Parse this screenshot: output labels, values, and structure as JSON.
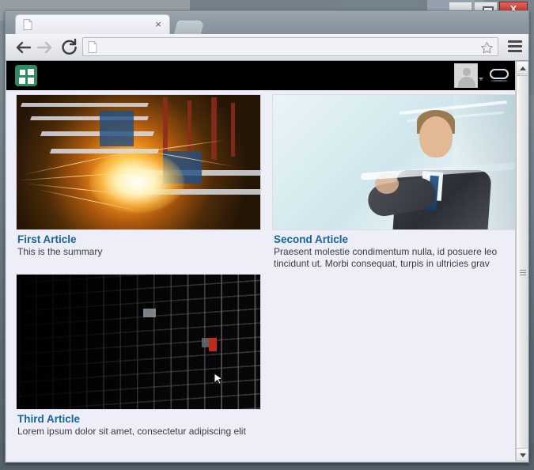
{
  "window": {
    "controls": {
      "minimize_label": "Minimize",
      "maximize_label": "Restore",
      "close_label": "X"
    }
  },
  "browser": {
    "tab": {
      "title": "",
      "favicon": "document-icon",
      "close_label": "×"
    },
    "new_tab_label": "",
    "toolbar": {
      "back_icon": "back-arrow-icon",
      "forward_icon": "forward-arrow-icon",
      "reload_icon": "reload-icon",
      "omnibox_value": "",
      "omnibox_placeholder": "",
      "omnibox_icon": "document-icon",
      "bookmark_icon": "star-icon",
      "menu_icon": "hamburger-menu-icon"
    }
  },
  "app": {
    "header": {
      "logo_name": "grid-logo",
      "logo_color": "#2e8b62",
      "avatar_name": "user-avatar",
      "avatar_caret": "chevron-down-icon",
      "chat_icon": "chat-bubble-icon"
    },
    "page_background": "#eeeef8",
    "link_color": "#1264a3",
    "articles": [
      {
        "title": "First Article",
        "summary": "This is the summary",
        "image_name": "factory-welding-sparks-photo"
      },
      {
        "title": "Second Article",
        "summary": "Praesent molestie condimentum nulla, id posuere leo tincidunt ut. Morbi consequat, turpis in ultricies grav",
        "image_name": "businessman-with-tablet-photo"
      },
      {
        "title": "Third Article",
        "summary": "Lorem ipsum dolor sit amet, consectetur adipiscing elit",
        "image_name": "dark-building-facade-photo"
      }
    ]
  },
  "scrollbar": {
    "up_arrow": "scroll-up-arrow",
    "down_arrow": "scroll-down-arrow",
    "thumb": "scroll-thumb"
  },
  "cursor": {
    "name": "mouse-pointer"
  }
}
